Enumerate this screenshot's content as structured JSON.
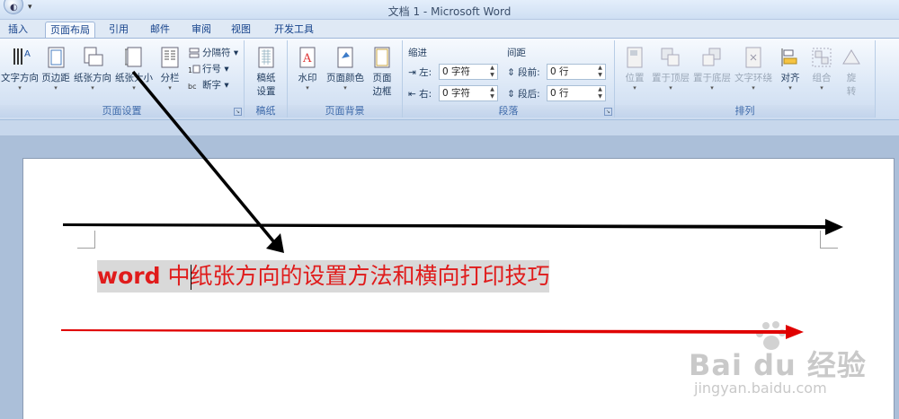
{
  "window": {
    "title": "文档 1 - Microsoft Word"
  },
  "tabs": [
    "插入",
    "页面布局",
    "引用",
    "邮件",
    "审阅",
    "视图",
    "开发工具"
  ],
  "active_tab": "页面布局",
  "ribbon": {
    "page_setup": {
      "label": "页面设置",
      "text_direction": "文字方向",
      "margins": "页边距",
      "orientation": "纸张方向",
      "size": "纸张大小",
      "columns": "分栏",
      "breaks": "分隔符",
      "line_numbers": "行号",
      "hyphenation": "断字"
    },
    "manuscript": {
      "label": "稿纸",
      "button": "稿纸设置",
      "button_line1": "稿纸",
      "button_line2": "设置"
    },
    "page_background": {
      "label": "页面背景",
      "watermark": "水印",
      "page_color": "页面颜色",
      "page_borders_line1": "页面",
      "page_borders_line2": "边框"
    },
    "paragraph": {
      "label": "段落",
      "indent_title": "缩进",
      "spacing_title": "间距",
      "indent_left_label": "左:",
      "indent_left_value": "0 字符",
      "indent_right_label": "右:",
      "indent_right_value": "0 字符",
      "spacing_before_label": "段前:",
      "spacing_before_value": "0 行",
      "spacing_after_label": "段后:",
      "spacing_after_value": "0 行"
    },
    "arrange": {
      "label": "排列",
      "position": "位置",
      "bring_front": "置于顶层",
      "send_back": "置于底层",
      "text_wrap": "文字环绕",
      "align": "对齐",
      "group": "组合",
      "rotate_line1": "旋",
      "rotate_line2": "转"
    }
  },
  "document": {
    "heading_bold": "word",
    "heading_rest": " 中纸张方向的设置方法和横向打印技巧"
  },
  "watermark": {
    "brand": "Bai du 经验",
    "url": "jingyan.baidu.com"
  },
  "colors": {
    "accent": "#15428b",
    "heading": "#e01b1b",
    "arrow_black": "#000000",
    "arrow_red": "#e00000"
  }
}
